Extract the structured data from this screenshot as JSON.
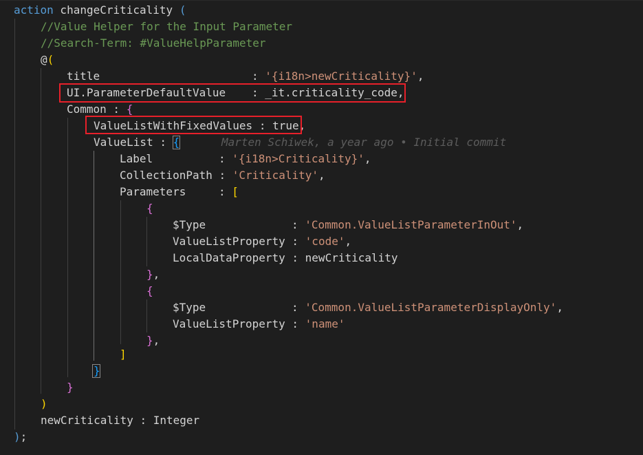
{
  "code": {
    "line1": {
      "kw": "action",
      "name": " changeCriticality ",
      "paren": "("
    },
    "comment1": "//Value Helper for the Input Parameter",
    "comment2": "//Search-Term: #ValueHelpParameter",
    "anno_open": {
      "at": "@",
      "paren": "("
    },
    "title_line": {
      "key": "title",
      "colon": ": ",
      "value": "'{i18n>newCriticality}'",
      "comma": ","
    },
    "param_default": {
      "key": "UI.ParameterDefaultValue",
      "colon": ": ",
      "value": "_it.criticality_code,"
    },
    "common_line": {
      "key": "Common : ",
      "brace": "{"
    },
    "fixed_values": {
      "key": "ValueListWithFixedValues : true",
      "comma": ","
    },
    "valuelist_line": {
      "key": "ValueList : ",
      "brace": "{"
    },
    "blame": "Marten Schiwek, a year ago • Initial commit",
    "label_line": {
      "key": "Label",
      "colon": ": ",
      "value": "'{i18n>Criticality}'",
      "comma": ","
    },
    "collection_line": {
      "key": "CollectionPath",
      "colon": " : ",
      "value": "'Criticality'",
      "comma": ","
    },
    "parameters_line": {
      "key": "Parameters",
      "colon": ": ",
      "bracket": "["
    },
    "p1_open": "{",
    "p1_type": {
      "key": "$Type",
      "colon": ": ",
      "value": "'Common.ValueListParameterInOut'",
      "comma": ","
    },
    "p1_vlp": {
      "key": "ValueListProperty",
      "colon": " : ",
      "value": "'code'",
      "comma": ","
    },
    "p1_ldp": {
      "key": "LocalDataProperty",
      "rest": " : newCriticality"
    },
    "p1_close": {
      "brace": "}",
      "comma": ","
    },
    "p2_open": "{",
    "p2_type": {
      "key": "$Type",
      "colon": ": ",
      "value": "'Common.ValueListParameterDisplayOnly'",
      "comma": ","
    },
    "p2_vlp": {
      "key": "ValueListProperty",
      "colon": " : ",
      "value": "'name'"
    },
    "p2_close": {
      "brace": "}",
      "comma": ","
    },
    "params_close": "]",
    "valuelist_close": "}",
    "common_close": "}",
    "anno_close": ")",
    "new_crit": "newCriticality : Integer",
    "end": {
      "paren": ")",
      "semi": ";"
    }
  },
  "colors": {
    "background": "#1e1e1e",
    "keyword": "#569cd6",
    "comment": "#6a9955",
    "string": "#ce9178",
    "highlight_box": "#e8202a"
  }
}
